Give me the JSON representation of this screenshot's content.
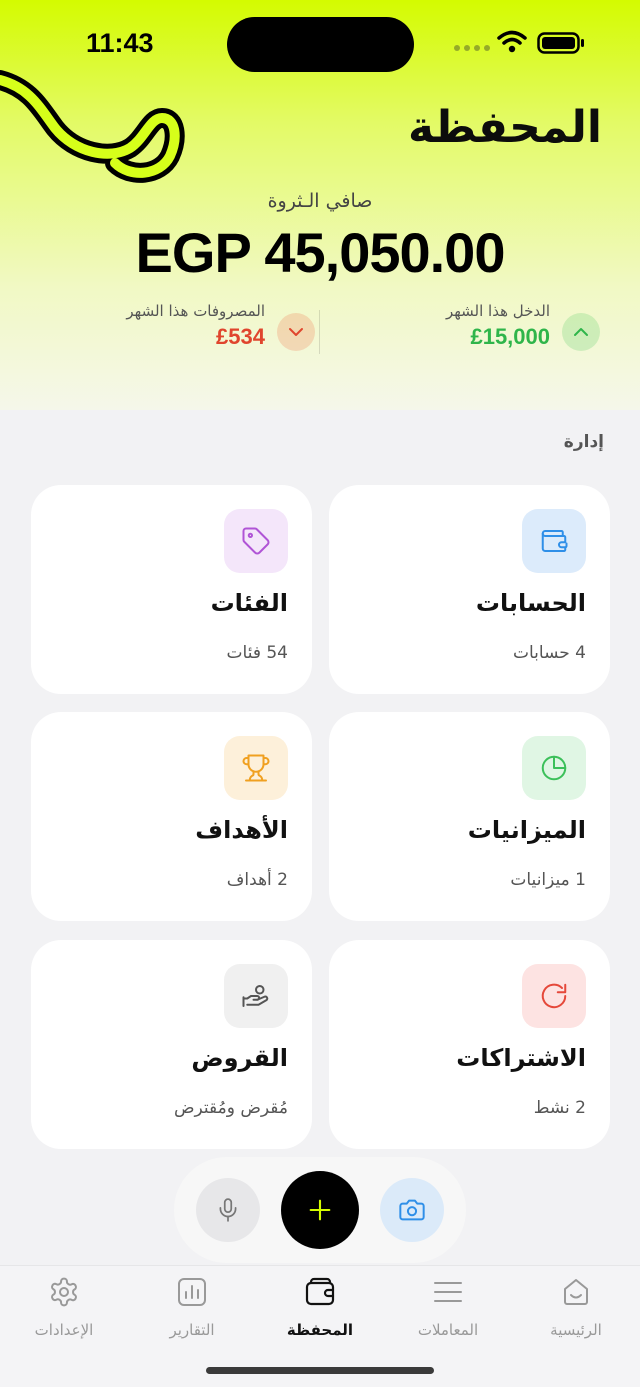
{
  "status_bar": {
    "time": "11:43"
  },
  "header": {
    "title": "المحفظة",
    "net_worth_label": "صافي الـثروة",
    "net_worth_value": "EGP 45,050.00"
  },
  "stats": {
    "income": {
      "label": "الدخل هذا الشهر",
      "value": "£15,000",
      "icon": "chevron-up-icon",
      "color": "#2fb54a"
    },
    "expense": {
      "label": "المصروفات هذا الشهر",
      "value": "£534",
      "icon": "chevron-down-icon",
      "color": "#e0452d"
    }
  },
  "section": {
    "label": "إدارة"
  },
  "cards": [
    {
      "id": "accounts",
      "title": "الحسابات",
      "subtitle": "4 حسابات",
      "icon": "wallet-icon",
      "accent": "#2f8fe8"
    },
    {
      "id": "categories",
      "title": "الفئات",
      "subtitle": "54 فئات",
      "icon": "tag-icon",
      "accent": "#b054d6"
    },
    {
      "id": "budgets",
      "title": "الميزانيات",
      "subtitle": "1 ميزانيات",
      "icon": "pie-chart-icon",
      "accent": "#3cc05a"
    },
    {
      "id": "goals",
      "title": "الأهداف",
      "subtitle": "2 أهداف",
      "icon": "trophy-icon",
      "accent": "#f0a020"
    },
    {
      "id": "subscriptions",
      "title": "الاشتراكات",
      "subtitle": "2 نشط",
      "icon": "refresh-icon",
      "accent": "#e5483a"
    },
    {
      "id": "loans",
      "title": "القروض",
      "subtitle": "مُقرض ومُقترض",
      "icon": "hand-coin-icon",
      "accent": "#555555"
    }
  ],
  "quick_actions": [
    "microphone-icon",
    "plus-icon",
    "camera-icon"
  ],
  "tabs": [
    {
      "label": "الرئيسية",
      "icon": "home-icon",
      "active": false
    },
    {
      "label": "المعاملات",
      "icon": "list-icon",
      "active": false
    },
    {
      "label": "المحفظة",
      "icon": "wallet-icon",
      "active": true
    },
    {
      "label": "التقارير",
      "icon": "bar-chart-icon",
      "active": false
    },
    {
      "label": "الإعدادات",
      "icon": "gear-icon",
      "active": false
    }
  ],
  "colors": {
    "brand": "#d4fb00",
    "income": "#2fb54a",
    "expense": "#e0452d"
  }
}
